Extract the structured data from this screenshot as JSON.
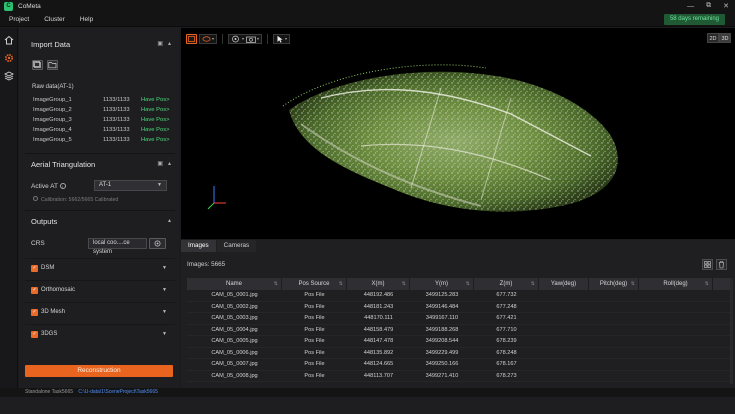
{
  "app": {
    "title": "CoMeta",
    "logo_letter": "C"
  },
  "window": {
    "minimize": "—",
    "restore": "⧉",
    "close": "✕"
  },
  "menu": [
    "Project",
    "Cluster",
    "Help"
  ],
  "trial": "58 days remaining",
  "rail_icons": [
    "home-icon",
    "settings-icon",
    "layers-icon"
  ],
  "import": {
    "title": "Import Data",
    "raw_title": "Raw data(AT-1)",
    "groups": [
      {
        "name": "ImageGroup_1",
        "count": "1133/1133",
        "state": "Have Pos>"
      },
      {
        "name": "ImageGroup_2",
        "count": "1133/1133",
        "state": "Have Pos>"
      },
      {
        "name": "ImageGroup_3",
        "count": "1133/1133",
        "state": "Have Pos>"
      },
      {
        "name": "ImageGroup_4",
        "count": "1133/1133",
        "state": "Have Pos>"
      },
      {
        "name": "ImageGroup_5",
        "count": "1133/1133",
        "state": "Have Pos>"
      }
    ]
  },
  "aerial": {
    "title": "Aerial Triangulation",
    "active_label": "Active AT",
    "active_value": "AT-1",
    "calibration": "Calibration: 5662/5665 Calibrated"
  },
  "outputs": {
    "title": "Outputs",
    "crs_label": "CRS",
    "crs_value": "local coo....ce system",
    "items": [
      "DSM",
      "Orthomosaic",
      "3D Mesh",
      "3DGS"
    ]
  },
  "reconstruction_label": "Reconstruction",
  "view_mode": [
    "2D",
    "3D"
  ],
  "tabs": [
    "Images",
    "Cameras"
  ],
  "images_count": "Images: 5665",
  "table": {
    "columns": [
      "Name",
      "Pos Source",
      "X(m)",
      "Y(m)",
      "Z(m)",
      "Yaw(deg)",
      "Pitch(deg)",
      "Roll(deg)"
    ],
    "rows": [
      [
        "CAM_05_0001.jpg",
        "Pos File",
        "448192.486",
        "3499125.283",
        "677.732",
        "",
        "",
        ""
      ],
      [
        "CAM_05_0002.jpg",
        "Pos File",
        "448181.243",
        "3499146.484",
        "677.248",
        "",
        "",
        ""
      ],
      [
        "CAM_05_0003.jpg",
        "Pos File",
        "448170.111",
        "3499167.110",
        "677.421",
        "",
        "",
        ""
      ],
      [
        "CAM_05_0004.jpg",
        "Pos File",
        "448158.479",
        "3499188.268",
        "677.710",
        "",
        "",
        ""
      ],
      [
        "CAM_05_0005.jpg",
        "Pos File",
        "448147.478",
        "3499208.544",
        "678.239",
        "",
        "",
        ""
      ],
      [
        "CAM_05_0006.jpg",
        "Pos File",
        "448135.892",
        "3499229.499",
        "678.248",
        "",
        "",
        ""
      ],
      [
        "CAM_05_0007.jpg",
        "Pos File",
        "448124.665",
        "3499250.166",
        "678.167",
        "",
        "",
        ""
      ],
      [
        "CAM_05_0008.jpg",
        "Pos File",
        "448113.707",
        "3499271.410",
        "678.273",
        "",
        "",
        ""
      ]
    ]
  },
  "status": {
    "left": "Standalone  Task5665",
    "path": "C:\\U-data\\1\\SceneProject\\Task5665"
  }
}
